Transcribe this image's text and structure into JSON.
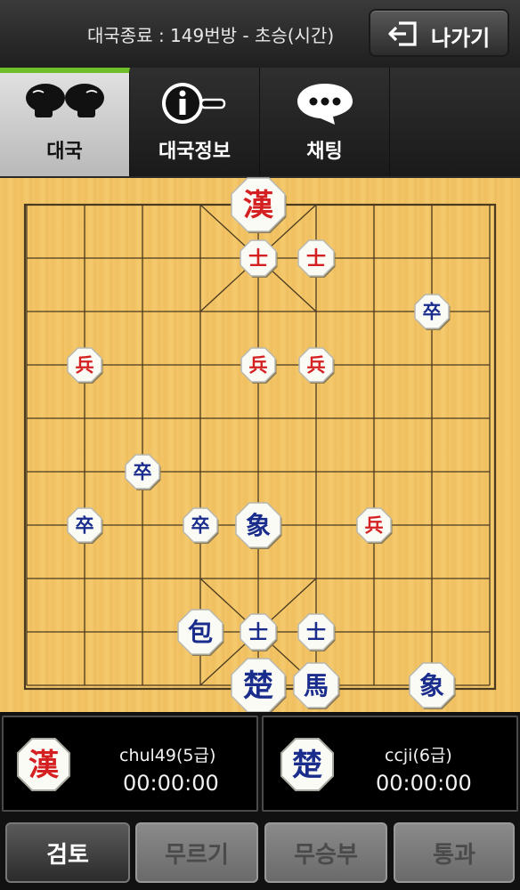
{
  "header": {
    "status": "대국종료 : 149번방 - 초승(시간)",
    "exit_label": "나가기"
  },
  "tabs": [
    {
      "label": "대국",
      "icon": "boxing-gloves-icon",
      "active": true
    },
    {
      "label": "대국정보",
      "icon": "info-icon",
      "active": false
    },
    {
      "label": "채팅",
      "icon": "chat-bubble-icon",
      "active": false
    }
  ],
  "board": {
    "files": 9,
    "ranks": 10,
    "pieces": [
      {
        "side": "red",
        "type": "king",
        "glyph": "漢",
        "file": 5,
        "rank": 1
      },
      {
        "side": "red",
        "type": "guard",
        "glyph": "士",
        "file": 5,
        "rank": 2
      },
      {
        "side": "red",
        "type": "guard",
        "glyph": "士",
        "file": 6,
        "rank": 2
      },
      {
        "side": "blue",
        "type": "soldier",
        "glyph": "卒",
        "file": 8,
        "rank": 3
      },
      {
        "side": "red",
        "type": "soldier",
        "glyph": "兵",
        "file": 2,
        "rank": 4
      },
      {
        "side": "red",
        "type": "soldier",
        "glyph": "兵",
        "file": 5,
        "rank": 4
      },
      {
        "side": "red",
        "type": "soldier",
        "glyph": "兵",
        "file": 6,
        "rank": 4
      },
      {
        "side": "blue",
        "type": "soldier",
        "glyph": "卒",
        "file": 3,
        "rank": 6
      },
      {
        "side": "blue",
        "type": "soldier",
        "glyph": "卒",
        "file": 2,
        "rank": 7
      },
      {
        "side": "blue",
        "type": "soldier",
        "glyph": "卒",
        "file": 4,
        "rank": 7
      },
      {
        "side": "blue",
        "type": "elephant",
        "glyph": "象",
        "file": 5,
        "rank": 7
      },
      {
        "side": "red",
        "type": "soldier",
        "glyph": "兵",
        "file": 7,
        "rank": 7
      },
      {
        "side": "blue",
        "type": "cannon",
        "glyph": "包",
        "file": 4,
        "rank": 9
      },
      {
        "side": "blue",
        "type": "guard",
        "glyph": "士",
        "file": 5,
        "rank": 9
      },
      {
        "side": "blue",
        "type": "guard",
        "glyph": "士",
        "file": 6,
        "rank": 9
      },
      {
        "side": "blue",
        "type": "king",
        "glyph": "楚",
        "file": 5,
        "rank": 10
      },
      {
        "side": "blue",
        "type": "horse",
        "glyph": "馬",
        "file": 6,
        "rank": 10
      },
      {
        "side": "blue",
        "type": "elephant",
        "glyph": "象",
        "file": 8,
        "rank": 10
      }
    ]
  },
  "players": [
    {
      "name": "chul49(5급)",
      "time": "00:00:00",
      "glyph": "漢",
      "color": "#d42020"
    },
    {
      "name": "ccji(6급)",
      "time": "00:00:00",
      "glyph": "楚",
      "color": "#1a2c8c"
    }
  ],
  "buttons": [
    {
      "label": "검토",
      "enabled": true
    },
    {
      "label": "무르기",
      "enabled": false
    },
    {
      "label": "무승부",
      "enabled": false
    },
    {
      "label": "통과",
      "enabled": false
    }
  ],
  "colors": {
    "red_piece": "#d42020",
    "blue_piece": "#1a2c8c",
    "board": "#f3c567",
    "active_tab_accent": "#6fbf2b"
  }
}
